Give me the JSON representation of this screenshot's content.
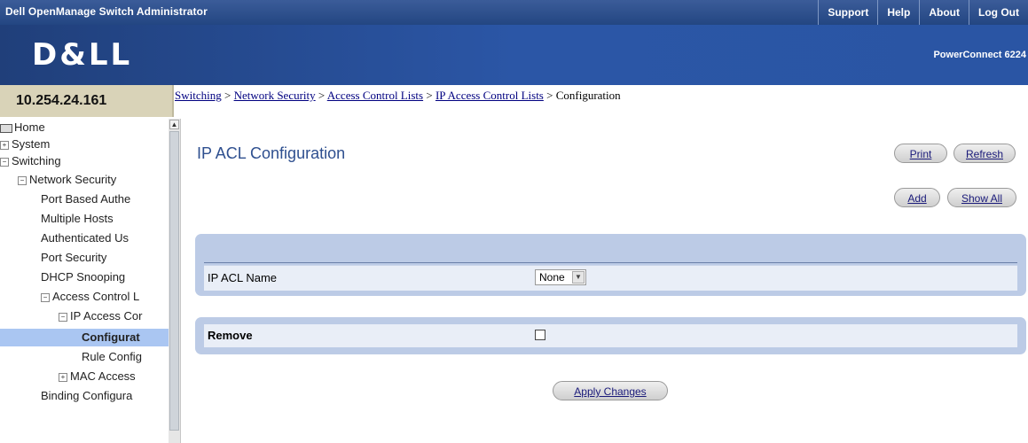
{
  "app": {
    "title": "Dell OpenManage Switch Administrator",
    "nav": [
      "Support",
      "Help",
      "About",
      "Log Out"
    ],
    "logo": "D&LL",
    "product": "PowerConnect 6224"
  },
  "ip_address": "10.254.24.161",
  "breadcrumb": {
    "links": [
      "Switching",
      "Network Security",
      "Access Control Lists",
      "IP Access Control Lists"
    ],
    "separator": " > ",
    "current": "Configuration"
  },
  "sidebar": {
    "items": [
      {
        "label": "Home",
        "icon": "home-icon"
      },
      {
        "label": "System",
        "icon": "expand-plus-icon"
      },
      {
        "label": "Switching",
        "icon": "collapse-minus-icon"
      },
      {
        "label": "Network Security",
        "icon": "collapse-minus-icon"
      },
      {
        "label": "Port Based Authe",
        "icon": ""
      },
      {
        "label": "Multiple Hosts",
        "icon": ""
      },
      {
        "label": "Authenticated Us",
        "icon": ""
      },
      {
        "label": "Port Security",
        "icon": ""
      },
      {
        "label": "DHCP Snooping",
        "icon": ""
      },
      {
        "label": "Access Control L",
        "icon": "collapse-minus-icon"
      },
      {
        "label": "IP Access Cor",
        "icon": "collapse-minus-icon"
      },
      {
        "label": "Configurat",
        "icon": "",
        "selected": true
      },
      {
        "label": "Rule Config",
        "icon": ""
      },
      {
        "label": "MAC Access",
        "icon": "expand-plus-icon"
      },
      {
        "label": "Binding Configura",
        "icon": ""
      }
    ]
  },
  "page": {
    "title": "IP ACL Configuration",
    "buttons": {
      "print": "Print",
      "refresh": "Refresh",
      "add": "Add",
      "show_all": "Show All",
      "apply": "Apply Changes"
    },
    "acl_name": {
      "label": "IP ACL Name",
      "value": "None"
    },
    "remove": {
      "label": "Remove",
      "checked": false
    }
  }
}
